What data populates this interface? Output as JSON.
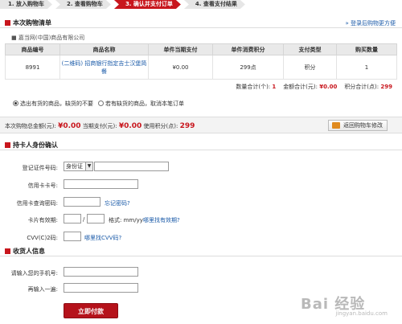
{
  "steps": [
    {
      "label": "1. 放入购物车"
    },
    {
      "label": "2. 查看购物车"
    },
    {
      "label": "3. 确认并支付订单"
    },
    {
      "label": "4. 查看支付结果"
    }
  ],
  "order_section": {
    "title": "本次购物清单",
    "right_link": "» 登录后购物更方便",
    "shop": "■ 嘉当网(中国)商品有限公司",
    "columns": [
      "商品编号",
      "商品名称",
      "单件当期支付",
      "单件消费积分",
      "支付类型",
      "购买数量"
    ],
    "rows": [
      {
        "id": "8991",
        "name": "(二维码) 招商银行指定吉士汉堡简餐",
        "price": "¥0.00",
        "points": "299点",
        "pay_type": "积分",
        "qty": "1"
      }
    ],
    "totals": {
      "qty_label": "数量合计(个):",
      "qty": "1",
      "amount_label": "金额合计(元):",
      "amount": "¥0.00",
      "points_label": "积分合计(点):",
      "points": "299"
    },
    "radio_options": [
      {
        "label": "选出有货的商品，缺货的不要",
        "selected": true
      },
      {
        "label": "若有缺货的商品，取消本笔订单",
        "selected": false
      }
    ]
  },
  "summary": {
    "total_label": "本次购物总金额(元):",
    "total_value": "¥0.00",
    "current_label": "当期支付(元):",
    "current_value": "¥0.00",
    "points_label": "使用积分(点):",
    "points_value": "299",
    "back_button": "返回购物车修改"
  },
  "identity_section": {
    "title": "持卡人身份确认",
    "id_label": "登记证件号码:",
    "id_type": "身份证",
    "card_label": "信用卡卡号:",
    "query_pwd_label": "信用卡查询密码:",
    "forgot_pwd": "忘记密码?",
    "expiry_label": "卡片有效期:",
    "expiry_sep": "/",
    "expiry_format": "格式: mm/yy",
    "expiry_help": "哪里找有效期?",
    "cvv_label": "CVV(C)2码:",
    "cvv_help": "哪里找CVV码?"
  },
  "receiver_section": {
    "title": "收货人信息",
    "phone_label": "请输入您的手机号:",
    "phone_confirm_label": "再输入一遍:"
  },
  "pay_button": "立即付款",
  "watermark": {
    "brand": "Bai 经验",
    "url": "jingyan.baidu.com"
  },
  "colors": {
    "accent": "#c8161d",
    "link": "#1a5aa8"
  }
}
